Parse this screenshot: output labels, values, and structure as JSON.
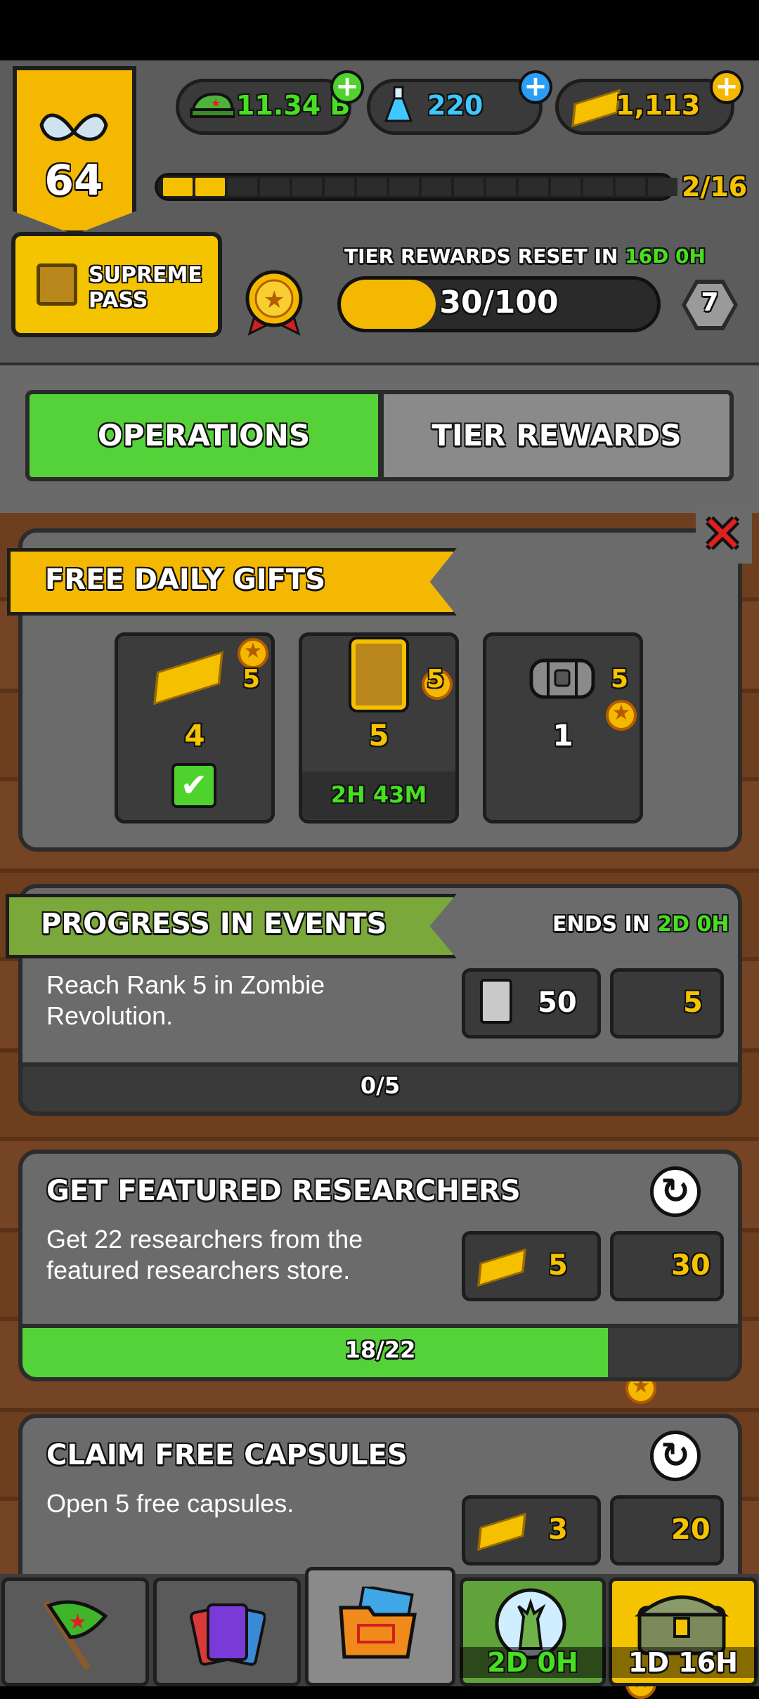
{
  "header": {
    "level": "64",
    "currencies": [
      {
        "name": "cash",
        "icon": "army-cap-icon",
        "value": "11.34 B"
      },
      {
        "name": "science",
        "icon": "flask-icon",
        "value": "220"
      },
      {
        "name": "gold",
        "icon": "gold-bars-icon",
        "value": "1,113"
      }
    ],
    "level_progress": {
      "text": "2/16",
      "segments_total": 16,
      "segments_filled": 2
    },
    "supreme_pass_label": "SUPREME\nPASS",
    "tier_reset_label": "TIER REWARDS RESET IN",
    "tier_reset_time": "16D 0H",
    "tier_progress": {
      "text": "30/100",
      "value": 30,
      "max": 100
    },
    "tier_number": "7"
  },
  "tabs": [
    {
      "label": "OPERATIONS",
      "active": true
    },
    {
      "label": "TIER REWARDS",
      "active": false
    }
  ],
  "daily_gifts": {
    "title": "FREE DAILY GIFTS",
    "items": [
      {
        "icon": "gold-bars-icon",
        "medal_count": "5",
        "amount": "4",
        "status": "claimed"
      },
      {
        "icon": "card-icon",
        "medal_count": "5",
        "amount": "5",
        "timer": "2H 43M"
      },
      {
        "icon": "locked-chest-icon",
        "medal_count": "5",
        "amount": "1"
      }
    ]
  },
  "events": {
    "title": "PROGRESS IN EVENTS",
    "ends_label": "ENDS IN",
    "ends_time": "2D 0H",
    "description": "Reach Rank 5 in Zombie Revolution.",
    "rewards": [
      {
        "icon": "card-icon",
        "value": "50"
      },
      {
        "icon": "medal-icon",
        "value": "5"
      }
    ],
    "progress": {
      "text": "0/5",
      "value": 0,
      "max": 5
    }
  },
  "researchers": {
    "title": "GET FEATURED RESEARCHERS",
    "description": "Get 22 researchers from the featured researchers store.",
    "rewards": [
      {
        "icon": "gold-bars-icon",
        "value": "5"
      },
      {
        "icon": "medal-icon",
        "value": "30"
      }
    ],
    "progress": {
      "text": "18/22",
      "value": 18,
      "max": 22
    }
  },
  "capsules": {
    "title": "CLAIM FREE CAPSULES",
    "description": "Open 5 free capsules.",
    "rewards": [
      {
        "icon": "gold-bars-icon",
        "value": "3"
      },
      {
        "icon": "medal-icon",
        "value": "20"
      }
    ]
  },
  "nav": [
    {
      "icon": "flag-icon"
    },
    {
      "icon": "cards-icon"
    },
    {
      "icon": "folder-icon",
      "active": true
    },
    {
      "icon": "zombie-globe-icon",
      "timer": "2D 0H"
    },
    {
      "icon": "treasure-chest-icon",
      "timer": "1D 16H"
    }
  ],
  "colors": {
    "accent_green": "#4fd22e",
    "gold": "#f5b800",
    "panel": "#6b6b6b",
    "wood": "#6e3f1f"
  }
}
